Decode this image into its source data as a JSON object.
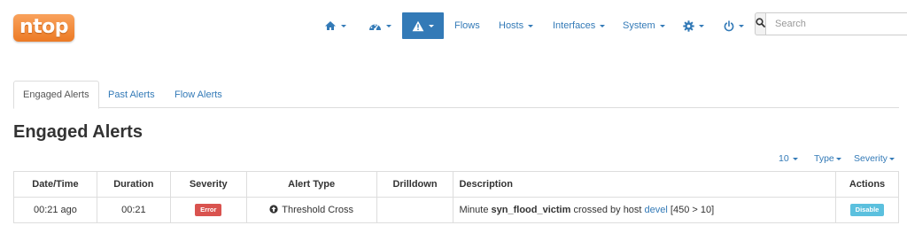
{
  "brand": {
    "logo_text": "ntop"
  },
  "navbar": {
    "items": [
      {
        "name": "home",
        "icon": "home-icon"
      },
      {
        "name": "dashboard",
        "icon": "dashboard-icon"
      },
      {
        "name": "alerts",
        "icon": "warning-icon",
        "active": true
      },
      {
        "label": "Flows"
      },
      {
        "label": "Hosts"
      },
      {
        "label": "Interfaces"
      },
      {
        "label": "System"
      },
      {
        "name": "settings",
        "icon": "gear-icon"
      },
      {
        "name": "power",
        "icon": "power-icon"
      }
    ],
    "search": {
      "placeholder": "Search",
      "value": ""
    }
  },
  "tabs": [
    {
      "label": "Engaged Alerts",
      "active": true
    },
    {
      "label": "Past Alerts"
    },
    {
      "label": "Flow Alerts"
    }
  ],
  "page_title": "Engaged Alerts",
  "table_toolbar": {
    "page_size": "10",
    "type_filter": "Type",
    "severity_filter": "Severity"
  },
  "table": {
    "columns": [
      "Date/Time",
      "Duration",
      "Severity",
      "Alert Type",
      "Drilldown",
      "Description",
      "Actions"
    ],
    "rows": [
      {
        "datetime": "00:21 ago",
        "duration": "00:21",
        "severity": "Error",
        "alert_type": "Threshold Cross",
        "drilldown": "",
        "description_prefix": "Minute ",
        "description_metric": "syn_flood_victim",
        "description_mid": " crossed by host ",
        "description_host": "devel",
        "description_suffix": " [450 > 10]",
        "action": "Disable"
      }
    ]
  },
  "colors": {
    "accent": "#337ab7",
    "brand_orange": "#ec7a25",
    "error": "#d9534f",
    "info": "#5bc0de"
  }
}
